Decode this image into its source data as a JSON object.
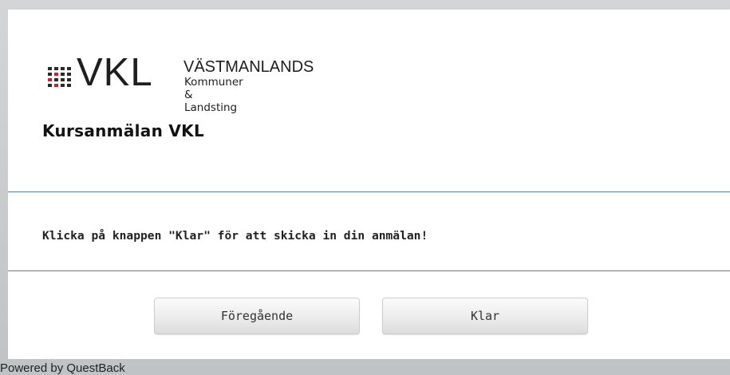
{
  "logo": {
    "letters": "VKL",
    "name": "VÄSTMANLANDS",
    "subtitle": "Kommuner & Landsting"
  },
  "survey": {
    "title": "Kursanmälan VKL",
    "message": "Klicka på knappen \"Klar\" för att skicka in din anmälan!"
  },
  "buttons": {
    "previous_label": "Föregående",
    "done_label": "Klar"
  },
  "footer": {
    "powered_by": "Powered by QuestBack"
  },
  "colors": {
    "divider": "#5b7fa3",
    "logo_accent": "#c0272d"
  }
}
